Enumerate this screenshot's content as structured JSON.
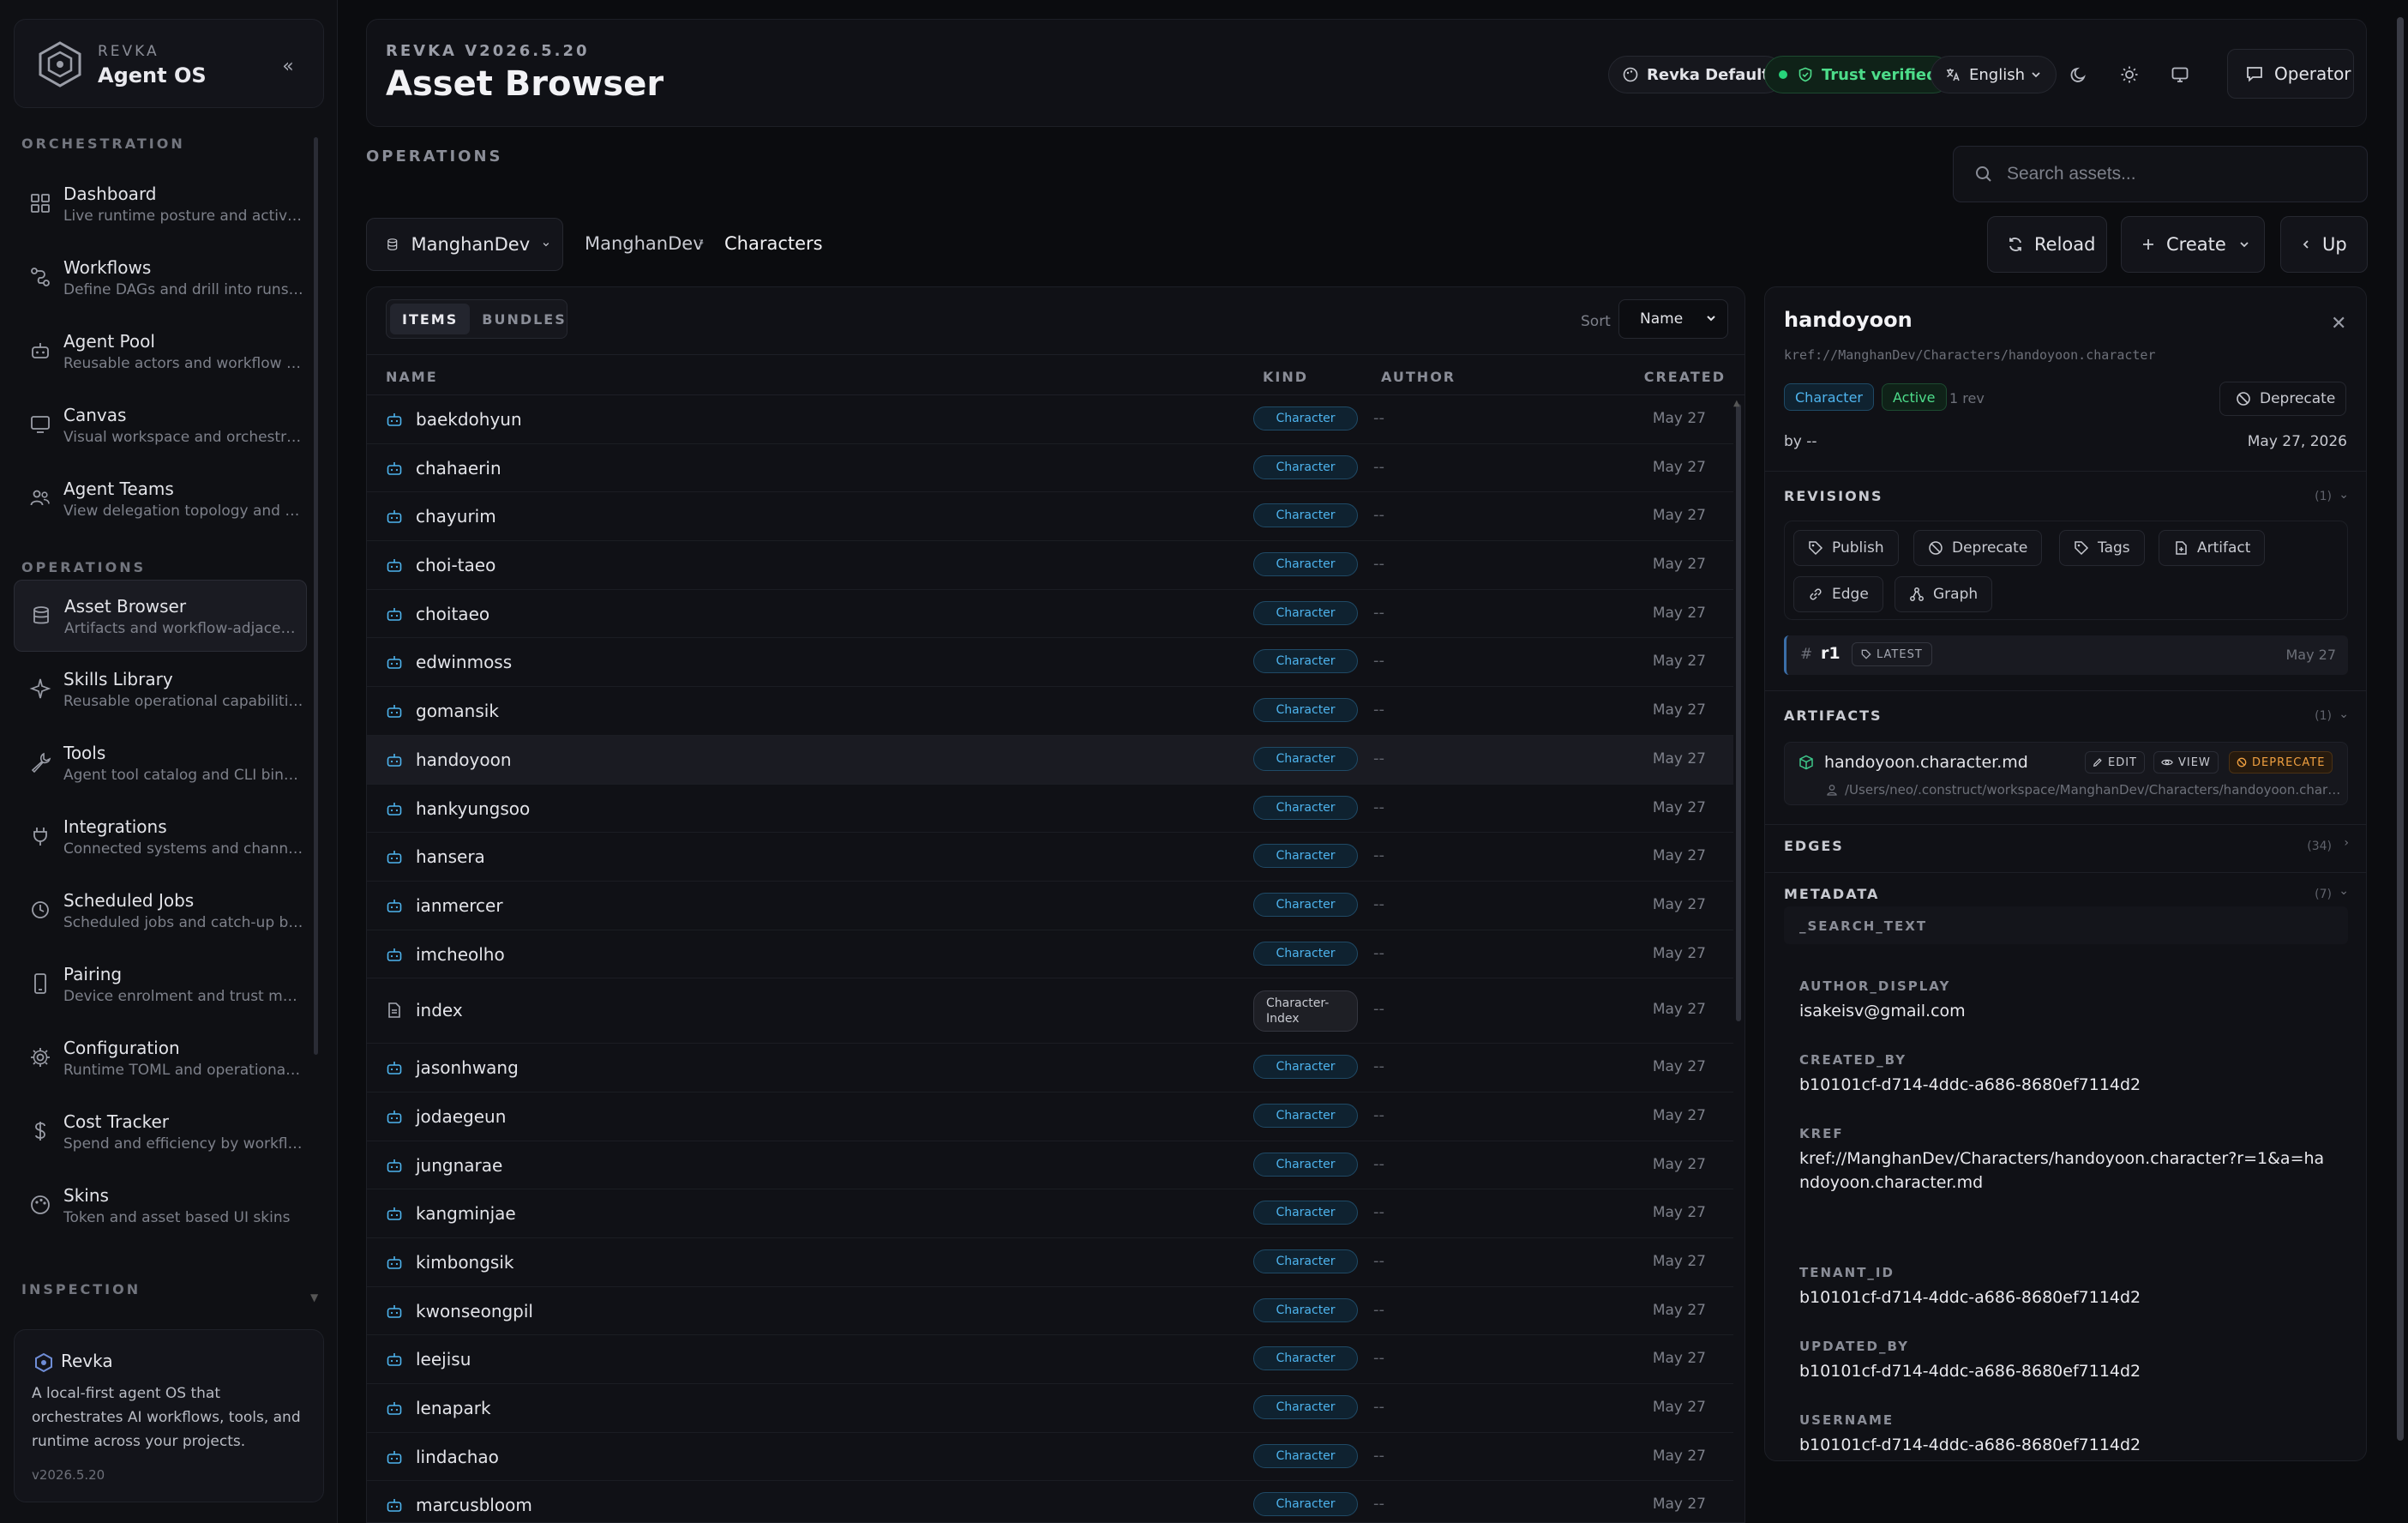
{
  "brand": {
    "small": "REVKA",
    "big": "Agent OS"
  },
  "sidebar": {
    "sections": [
      "ORCHESTRATION",
      "OPERATIONS",
      "INSPECTION"
    ],
    "items": [
      {
        "label": "Dashboard",
        "desc": "Live runtime posture and active ...",
        "icon": "dashboard-icon"
      },
      {
        "label": "Workflows",
        "desc": "Define DAGs and drill into runs f...",
        "icon": "workflow-icon"
      },
      {
        "label": "Agent Pool",
        "desc": "Reusable actors and workflow pa...",
        "icon": "robot-icon"
      },
      {
        "label": "Canvas",
        "desc": "Visual workspace and orchestrati...",
        "icon": "monitor-icon"
      },
      {
        "label": "Agent Teams",
        "desc": "View delegation topology and o...",
        "icon": "team-icon"
      },
      {
        "label": "Asset Browser",
        "desc": "Artifacts and workflow-adjacent r...",
        "icon": "database-icon"
      },
      {
        "label": "Skills Library",
        "desc": "Reusable operational capabilities",
        "icon": "sparkle-icon"
      },
      {
        "label": "Tools",
        "desc": "Agent tool catalog and CLI binar...",
        "icon": "wrench-icon"
      },
      {
        "label": "Integrations",
        "desc": "Connected systems and channel ...",
        "icon": "plug-icon"
      },
      {
        "label": "Scheduled Jobs",
        "desc": "Scheduled jobs and catch-up be...",
        "icon": "clock-icon"
      },
      {
        "label": "Pairing",
        "desc": "Device enrolment and trust man...",
        "icon": "phone-icon"
      },
      {
        "label": "Configuration",
        "desc": "Runtime TOML and operational c...",
        "icon": "gear-icon"
      },
      {
        "label": "Cost Tracker",
        "desc": "Spend and efficiency by workflo...",
        "icon": "dollar-icon"
      },
      {
        "label": "Skins",
        "desc": "Token and asset based UI skins",
        "icon": "palette-icon"
      }
    ],
    "about": {
      "name": "Revka",
      "desc": "A local-first agent OS that orchestrates AI workflows, tools, and runtime across your projects.",
      "version": "v2026.5.20"
    }
  },
  "header": {
    "version": "REVKA V2026.5.20",
    "title": "Asset Browser",
    "profile": "Revka Default",
    "trust": "Trust verified",
    "language": "English",
    "operator": "Operator"
  },
  "ops_label": "OPERATIONS",
  "search": {
    "placeholder": "Search assets..."
  },
  "toolbar": {
    "workspace": "ManghanDev",
    "breadcrumb": [
      "ManghanDev",
      "Characters"
    ],
    "reload": "Reload",
    "create": "Create",
    "up": "Up"
  },
  "list": {
    "tabs": [
      "ITEMS",
      "BUNDLES"
    ],
    "sort_label": "Sort",
    "sort_value": "Name",
    "columns": [
      "NAME",
      "KIND",
      "AUTHOR",
      "CREATED"
    ],
    "rows": [
      {
        "name": "baekdohyun",
        "kind": "Character",
        "author": "--",
        "created": "May 27"
      },
      {
        "name": "chahaerin",
        "kind": "Character",
        "author": "--",
        "created": "May 27"
      },
      {
        "name": "chayurim",
        "kind": "Character",
        "author": "--",
        "created": "May 27"
      },
      {
        "name": "choi-taeo",
        "kind": "Character",
        "author": "--",
        "created": "May 27"
      },
      {
        "name": "choitaeo",
        "kind": "Character",
        "author": "--",
        "created": "May 27"
      },
      {
        "name": "edwinmoss",
        "kind": "Character",
        "author": "--",
        "created": "May 27"
      },
      {
        "name": "gomansik",
        "kind": "Character",
        "author": "--",
        "created": "May 27"
      },
      {
        "name": "handoyoon",
        "kind": "Character",
        "author": "--",
        "created": "May 27",
        "selected": true
      },
      {
        "name": "hankyungsoo",
        "kind": "Character",
        "author": "--",
        "created": "May 27"
      },
      {
        "name": "hansera",
        "kind": "Character",
        "author": "--",
        "created": "May 27"
      },
      {
        "name": "ianmercer",
        "kind": "Character",
        "author": "--",
        "created": "May 27"
      },
      {
        "name": "imcheolho",
        "kind": "Character",
        "author": "--",
        "created": "May 27"
      },
      {
        "name": "index",
        "kind": "Character-Index",
        "author": "--",
        "created": "May 27",
        "doc": true
      },
      {
        "name": "jasonhwang",
        "kind": "Character",
        "author": "--",
        "created": "May 27"
      },
      {
        "name": "jodaegeun",
        "kind": "Character",
        "author": "--",
        "created": "May 27"
      },
      {
        "name": "jungnarae",
        "kind": "Character",
        "author": "--",
        "created": "May 27"
      },
      {
        "name": "kangminjae",
        "kind": "Character",
        "author": "--",
        "created": "May 27"
      },
      {
        "name": "kimbongsik",
        "kind": "Character",
        "author": "--",
        "created": "May 27"
      },
      {
        "name": "kwonseongpil",
        "kind": "Character",
        "author": "--",
        "created": "May 27"
      },
      {
        "name": "leejisu",
        "kind": "Character",
        "author": "--",
        "created": "May 27"
      },
      {
        "name": "lenapark",
        "kind": "Character",
        "author": "--",
        "created": "May 27"
      },
      {
        "name": "lindachao",
        "kind": "Character",
        "author": "--",
        "created": "May 27"
      },
      {
        "name": "marcusbloom",
        "kind": "Character",
        "author": "--",
        "created": "May 27"
      }
    ]
  },
  "detail": {
    "title": "handoyoon",
    "kref": "kref://ManghanDev/Characters/handoyoon.character",
    "kind_badge": "Character",
    "status_badge": "Active",
    "rev_count": "1 rev",
    "deprecate": "Deprecate",
    "by": "by --",
    "date": "May 27, 2026",
    "revisions": {
      "heading": "REVISIONS",
      "count": "(1)",
      "actions": [
        "Publish",
        "Deprecate",
        "Tags",
        "Artifact",
        "Edge",
        "Graph"
      ],
      "rev": {
        "hash": "#",
        "name": "r1",
        "tag": "LATEST",
        "date": "May 27"
      }
    },
    "artifacts": {
      "heading": "ARTIFACTS",
      "count": "(1)",
      "name": "handoyoon.character.md",
      "edit": "EDIT",
      "view": "VIEW",
      "deprecate": "DEPRECATE",
      "path": "/Users/neo/.construct/workspace/ManghanDev/Characters/handoyoon.character.md"
    },
    "edges": {
      "heading": "EDGES",
      "count": "(34)"
    },
    "metadata": {
      "heading": "METADATA",
      "count": "(7)",
      "first_key": "_SEARCH_TEXT",
      "entries": [
        {
          "key": "AUTHOR_DISPLAY",
          "value": "isakeisv@gmail.com"
        },
        {
          "key": "CREATED_BY",
          "value": "b10101cf-d714-4ddc-a686-8680ef7114d2"
        },
        {
          "key": "KREF",
          "value": "kref://ManghanDev/Characters/handoyoon.character?r=1&a=handoyoon.character.md"
        },
        {
          "key": "TENANT_ID",
          "value": "b10101cf-d714-4ddc-a686-8680ef7114d2"
        },
        {
          "key": "UPDATED_BY",
          "value": "b10101cf-d714-4ddc-a686-8680ef7114d2"
        },
        {
          "key": "USERNAME",
          "value": "b10101cf-d714-4ddc-a686-8680ef7114d2"
        }
      ]
    }
  },
  "colors": {
    "accent_blue": "#4eb4ee",
    "success_green": "#4ddc8a",
    "warning_orange": "#f0a040",
    "background": "#0b0c0f"
  }
}
